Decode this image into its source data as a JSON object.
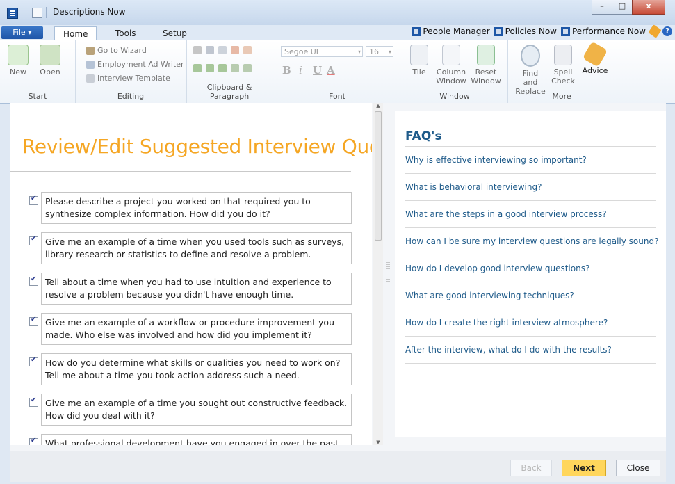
{
  "window": {
    "title": "Descriptions Now",
    "controls": [
      "–",
      "□",
      "x"
    ]
  },
  "ribbon_tabs": {
    "file": "File ▾",
    "tabs": [
      "Home",
      "Tools",
      "Setup"
    ]
  },
  "quick_links": [
    "People Manager",
    "Policies Now",
    "Performance Now"
  ],
  "ribbon": {
    "start": {
      "label": "Start",
      "new": "New",
      "open": "Open"
    },
    "editing": {
      "label": "Editing",
      "items": [
        "Go to Wizard",
        "Employment Ad Writer",
        "Interview Template"
      ]
    },
    "clipboard": {
      "label": "Clipboard & Paragraph"
    },
    "font": {
      "label": "Font",
      "family": "Segoe UI",
      "size": "16",
      "bold": "B",
      "italic": "i",
      "underline": "U",
      "color": "A"
    },
    "window": {
      "label": "Window",
      "tile": "Tile",
      "column_window": "Column Window",
      "reset_window": "Reset Window"
    },
    "more": {
      "label": "More",
      "find_replace": "Find and Replace",
      "spell_check": "Spell Check",
      "advice": "Advice"
    }
  },
  "main": {
    "title": "Review/Edit Suggested Interview Questions",
    "questions": [
      "Please describe a project you worked on that required you to synthesize complex information. How did you do it?",
      "Give me an example of a time when you used tools such as surveys, library research or statistics to define and resolve a problem.",
      "Tell about a time when you had to use intuition and experience to resolve a problem because you didn't have enough time.",
      "Give me an example of a workflow or procedure improvement you made. Who else was involved and how did you implement it?",
      "How do you determine what skills or qualities you need to work on? Tell me about a time you took action address such a need.",
      "Give me an example of a time you sought out constructive feedback. How did you deal with it?",
      "What professional development have you engaged in over the past"
    ]
  },
  "faq": {
    "title": "FAQ's",
    "items": [
      "Why is effective interviewing so important?",
      "What is behavioral interviewing?",
      "What are the steps in a good interview process?",
      "How can I be sure my interview questions are legally sound?",
      "How do I develop good interview questions?",
      "What are good  interviewing techniques?",
      "How do I create the right interview atmosphere?",
      "After the interview, what do I do with the results?"
    ]
  },
  "footer": {
    "back": "Back",
    "next": "Next",
    "close": "Close"
  },
  "colors": {
    "accent_title": "#f5a623",
    "faq_link": "#1f5b8a",
    "next_button": "#ffd65c"
  }
}
